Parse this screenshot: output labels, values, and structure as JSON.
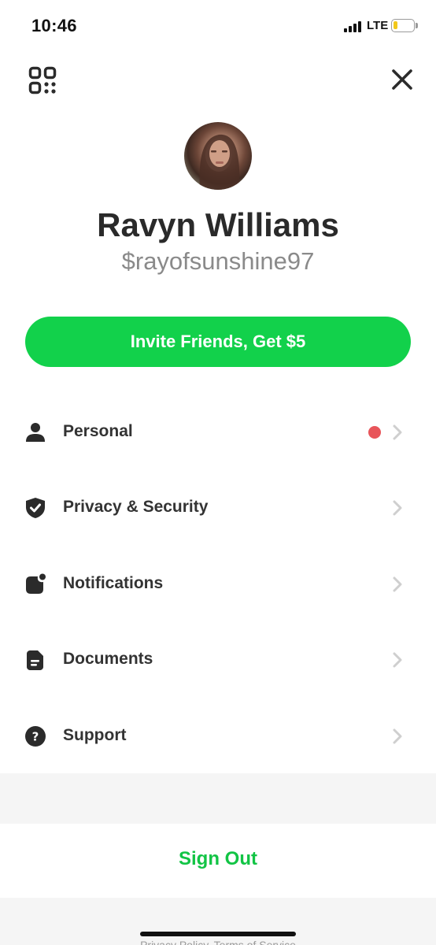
{
  "status_bar": {
    "time": "10:46",
    "network": "LTE",
    "battery_level": 0.2,
    "battery_color": "#f2c81a",
    "signal_bars": 4
  },
  "header": {
    "qr_icon": "qr-code-icon",
    "close_icon": "close-icon"
  },
  "profile": {
    "name": "Ravyn Williams",
    "cashtag": "$rayofsunshine97"
  },
  "invite": {
    "label": "Invite Friends, Get $5",
    "color": "#12d14b"
  },
  "menu": {
    "items": [
      {
        "label": "Personal",
        "icon": "person-icon",
        "has_alert_dot": true
      },
      {
        "label": "Privacy & Security",
        "icon": "shield-check-icon",
        "has_alert_dot": false
      },
      {
        "label": "Notifications",
        "icon": "notification-badge-icon",
        "has_alert_dot": false
      },
      {
        "label": "Documents",
        "icon": "document-icon",
        "has_alert_dot": false
      },
      {
        "label": "Support",
        "icon": "question-circle-icon",
        "has_alert_dot": false
      }
    ],
    "alert_dot_color": "#e8555a"
  },
  "sign_out": {
    "label": "Sign Out",
    "color": "#12c445"
  },
  "footer": {
    "links": "Privacy Policy, Terms of Service"
  }
}
